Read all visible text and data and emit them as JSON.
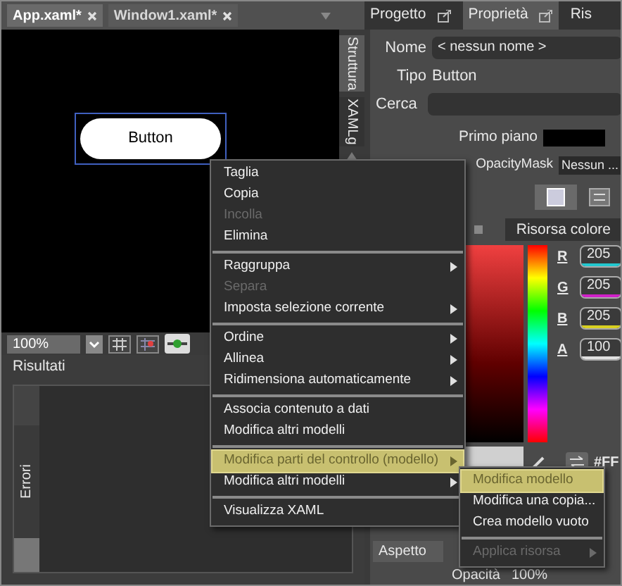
{
  "document_tabs": [
    {
      "label": "App.xaml*",
      "selected": true
    },
    {
      "label": "Window1.xaml*",
      "selected": false
    }
  ],
  "side_tabs": [
    "Struttura",
    "XAMLg"
  ],
  "canvas": {
    "button_label": "Button"
  },
  "toolbar": {
    "zoom": "100%"
  },
  "results": {
    "title": "Risultati",
    "tab": "Errori"
  },
  "panel_tabs": [
    {
      "label": "Progetto",
      "selected": false
    },
    {
      "label": "Proprietà",
      "selected": true
    },
    {
      "label": "Ris",
      "selected": false
    }
  ],
  "properties": {
    "name_label": "Nome",
    "name_value": "< nessun nome >",
    "type_label": "Tipo",
    "type_value": "Button",
    "search_label": "Cerca",
    "foreground_label": "Primo piano",
    "opacity_mask_label": "OpacityMask",
    "opacity_mask_value": "Nessun ...",
    "color_resource": "Risorsa colore",
    "channels": [
      {
        "label": "R",
        "value": "205",
        "color": "#22c8d0"
      },
      {
        "label": "G",
        "value": "205",
        "color": "#d020c8"
      },
      {
        "label": "B",
        "value": "205",
        "color": "#d8d020"
      },
      {
        "label": "A",
        "value": "100",
        "color": "#e0e0e0"
      }
    ],
    "hex": "#FF",
    "appearance": "Aspetto",
    "opacity_label": "Opacità",
    "opacity_value": "100%"
  },
  "context_menu": [
    [
      {
        "label": "Taglia",
        "disabled": false,
        "submenu": false,
        "selected": false
      },
      {
        "label": "Copia",
        "disabled": false,
        "submenu": false,
        "selected": false
      },
      {
        "label": "Incolla",
        "disabled": true,
        "submenu": false,
        "selected": false
      },
      {
        "label": "Elimina",
        "disabled": false,
        "submenu": false,
        "selected": false
      }
    ],
    [
      {
        "label": "Raggruppa",
        "disabled": false,
        "submenu": true,
        "selected": false
      },
      {
        "label": "Separa",
        "disabled": true,
        "submenu": false,
        "selected": false
      },
      {
        "label": "Imposta selezione corrente",
        "disabled": false,
        "submenu": true,
        "selected": false
      }
    ],
    [
      {
        "label": "Ordine",
        "disabled": false,
        "submenu": true,
        "selected": false
      },
      {
        "label": "Allinea",
        "disabled": false,
        "submenu": true,
        "selected": false
      },
      {
        "label": "Ridimensiona automaticamente",
        "disabled": false,
        "submenu": true,
        "selected": false
      }
    ],
    [
      {
        "label": "Associa contenuto a dati",
        "disabled": false,
        "submenu": false,
        "selected": false
      },
      {
        "label": "Modifica altri modelli",
        "disabled": false,
        "submenu": false,
        "selected": false
      }
    ],
    [
      {
        "label": "Modifica parti del controllo (modello)",
        "disabled": false,
        "submenu": true,
        "selected": true
      },
      {
        "label": "Modifica altri modelli",
        "disabled": false,
        "submenu": true,
        "selected": false
      }
    ],
    [
      {
        "label": "Visualizza XAML",
        "disabled": false,
        "submenu": false,
        "selected": false
      }
    ]
  ],
  "submenu": [
    [
      {
        "label": "Modifica modello",
        "disabled": false,
        "submenu": false,
        "selected": true
      },
      {
        "label": "Modifica una copia...",
        "disabled": false,
        "submenu": false,
        "selected": false
      },
      {
        "label": "Crea modello vuoto",
        "disabled": false,
        "submenu": false,
        "selected": false
      }
    ],
    [
      {
        "label": "Applica risorsa",
        "disabled": true,
        "submenu": true,
        "selected": false
      }
    ]
  ]
}
